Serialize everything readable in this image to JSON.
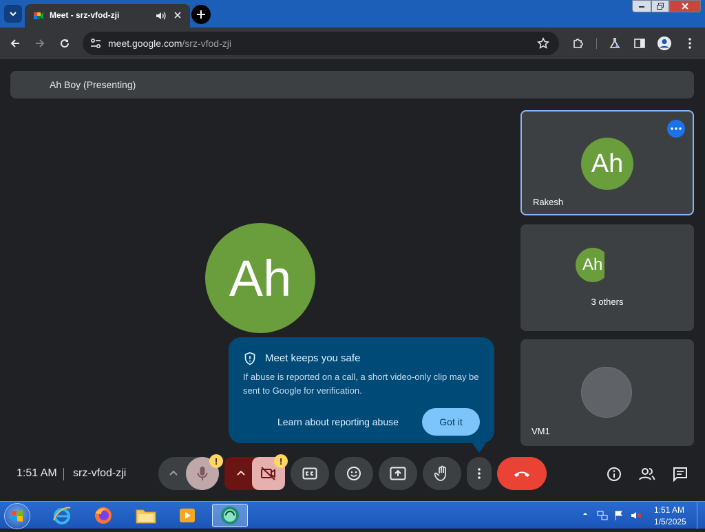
{
  "browser": {
    "tab": {
      "title": "Meet - srz-vfod-zji"
    },
    "address": {
      "host": "meet.google.com",
      "path": "/srz-vfod-zji"
    }
  },
  "meet": {
    "presenting_label": "Ah Boy (Presenting)",
    "main_avatar_initials": "Ah",
    "tiles": [
      {
        "name": "Rakesh",
        "initials": "Ah"
      },
      {
        "label": "3 others",
        "initials": "Ah"
      },
      {
        "name": "VM1"
      }
    ],
    "popup": {
      "title": "Meet keeps you safe",
      "body": "If abuse is reported on a call, a short video-only clip may be sent to Google for verification.",
      "link": "Learn about reporting abuse",
      "button": "Got it"
    },
    "bottom_bar": {
      "time": "1:51 AM",
      "meeting_code": "srz-vfod-zji",
      "warning_badge": "!"
    }
  },
  "taskbar": {
    "time": "1:51 AM",
    "date": "1/5/2025"
  },
  "colors": {
    "accent_blue": "#1a73e8",
    "avatar_green": "#6a9d3c",
    "hangup_red": "#ea4335",
    "popup_blue": "#004a77",
    "stage_bg": "#202124"
  }
}
